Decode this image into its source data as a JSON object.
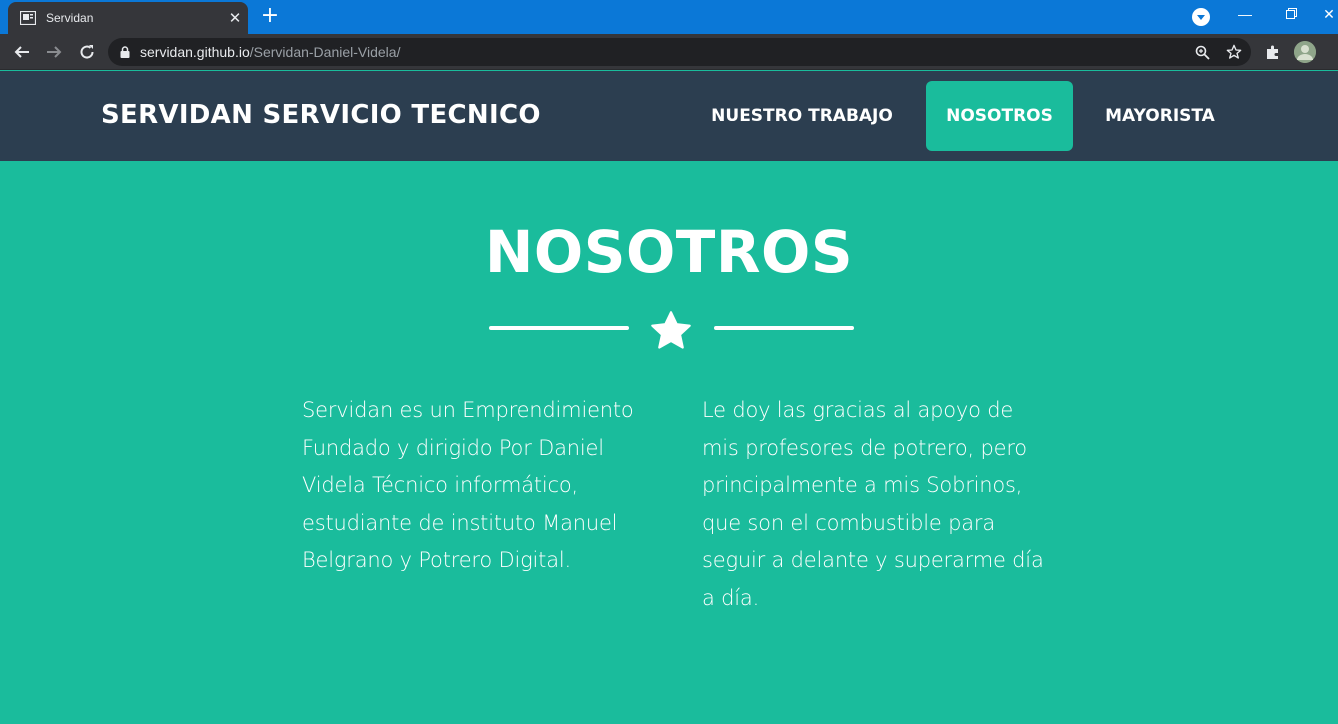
{
  "browser": {
    "tab_title": "Servidan",
    "url_host": "servidan.github.io",
    "url_path": "/Servidan-Daniel-Videla/",
    "icons": [
      "tab-favicon-icon",
      "close-icon",
      "plus-icon",
      "chevron-down-icon",
      "minimize-icon",
      "restore-icon",
      "close-window-icon",
      "back-arrow-icon",
      "forward-arrow-icon",
      "reload-icon",
      "lock-icon",
      "zoom-icon",
      "star-bookmark-icon",
      "extensions-puzzle-icon",
      "profile-avatar"
    ]
  },
  "site": {
    "brand": "SERVIDAN SERVICIO TECNICO",
    "nav": [
      {
        "label": "NUESTRO TRABAJO",
        "active": false
      },
      {
        "label": "NOSOTROS",
        "active": true
      },
      {
        "label": "MAYORISTA",
        "active": false
      }
    ],
    "colors": {
      "primary": "#1abc9c",
      "navbar": "#2c3e50",
      "text": "#ffffff"
    }
  },
  "about": {
    "title": "NOSOTROS",
    "divider_icon": "star-icon",
    "paragraph_left": "Servidan es un Emprendimiento Fundado y dirigido Por Daniel Videla Técnico informático, estudiante de instituto Manuel Belgrano y Potrero Digital.",
    "paragraph_right": "Le doy las gracias al apoyo de mis profesores de potrero, pero principalmente a mis Sobrinos, que son el combustible para seguir a delante y superarme día a día."
  }
}
